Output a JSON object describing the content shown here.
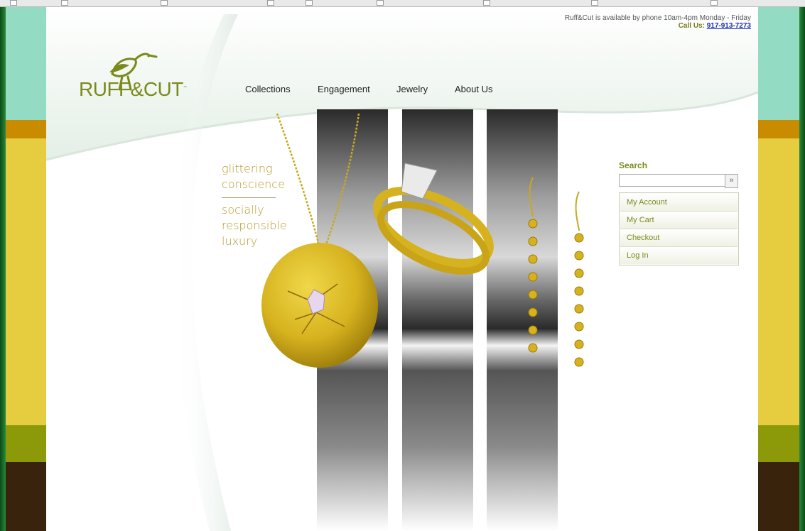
{
  "site": {
    "brand_name": "RUFF&CUT",
    "trademark": "™"
  },
  "contact": {
    "availability": "Ruff&Cut is available by phone 10am-4pm Monday - Friday",
    "call_label": "Call Us:",
    "phone": "917-913-7273"
  },
  "nav": {
    "items": [
      {
        "label": "Collections"
      },
      {
        "label": "Engagement"
      },
      {
        "label": "Jewelry"
      },
      {
        "label": "About Us"
      }
    ]
  },
  "tagline": {
    "line1": "glittering",
    "line2": "conscience",
    "line3": "socially",
    "line4": "responsible",
    "line5": "luxury"
  },
  "sidebar": {
    "search_label": "Search",
    "search_button": "»",
    "account_items": [
      {
        "label": "My Account"
      },
      {
        "label": "My Cart"
      },
      {
        "label": "Checkout"
      },
      {
        "label": "Log In"
      }
    ]
  },
  "colors": {
    "brand_olive": "#7a8a1a",
    "gold_text": "#b59a2a",
    "link_blue": "#1a2fb0",
    "side_teal": "#93dcc3",
    "side_orange": "#c98b00",
    "side_yellow": "#e6cc3f",
    "side_olive": "#8c9a0a",
    "side_brown": "#3a230c"
  }
}
